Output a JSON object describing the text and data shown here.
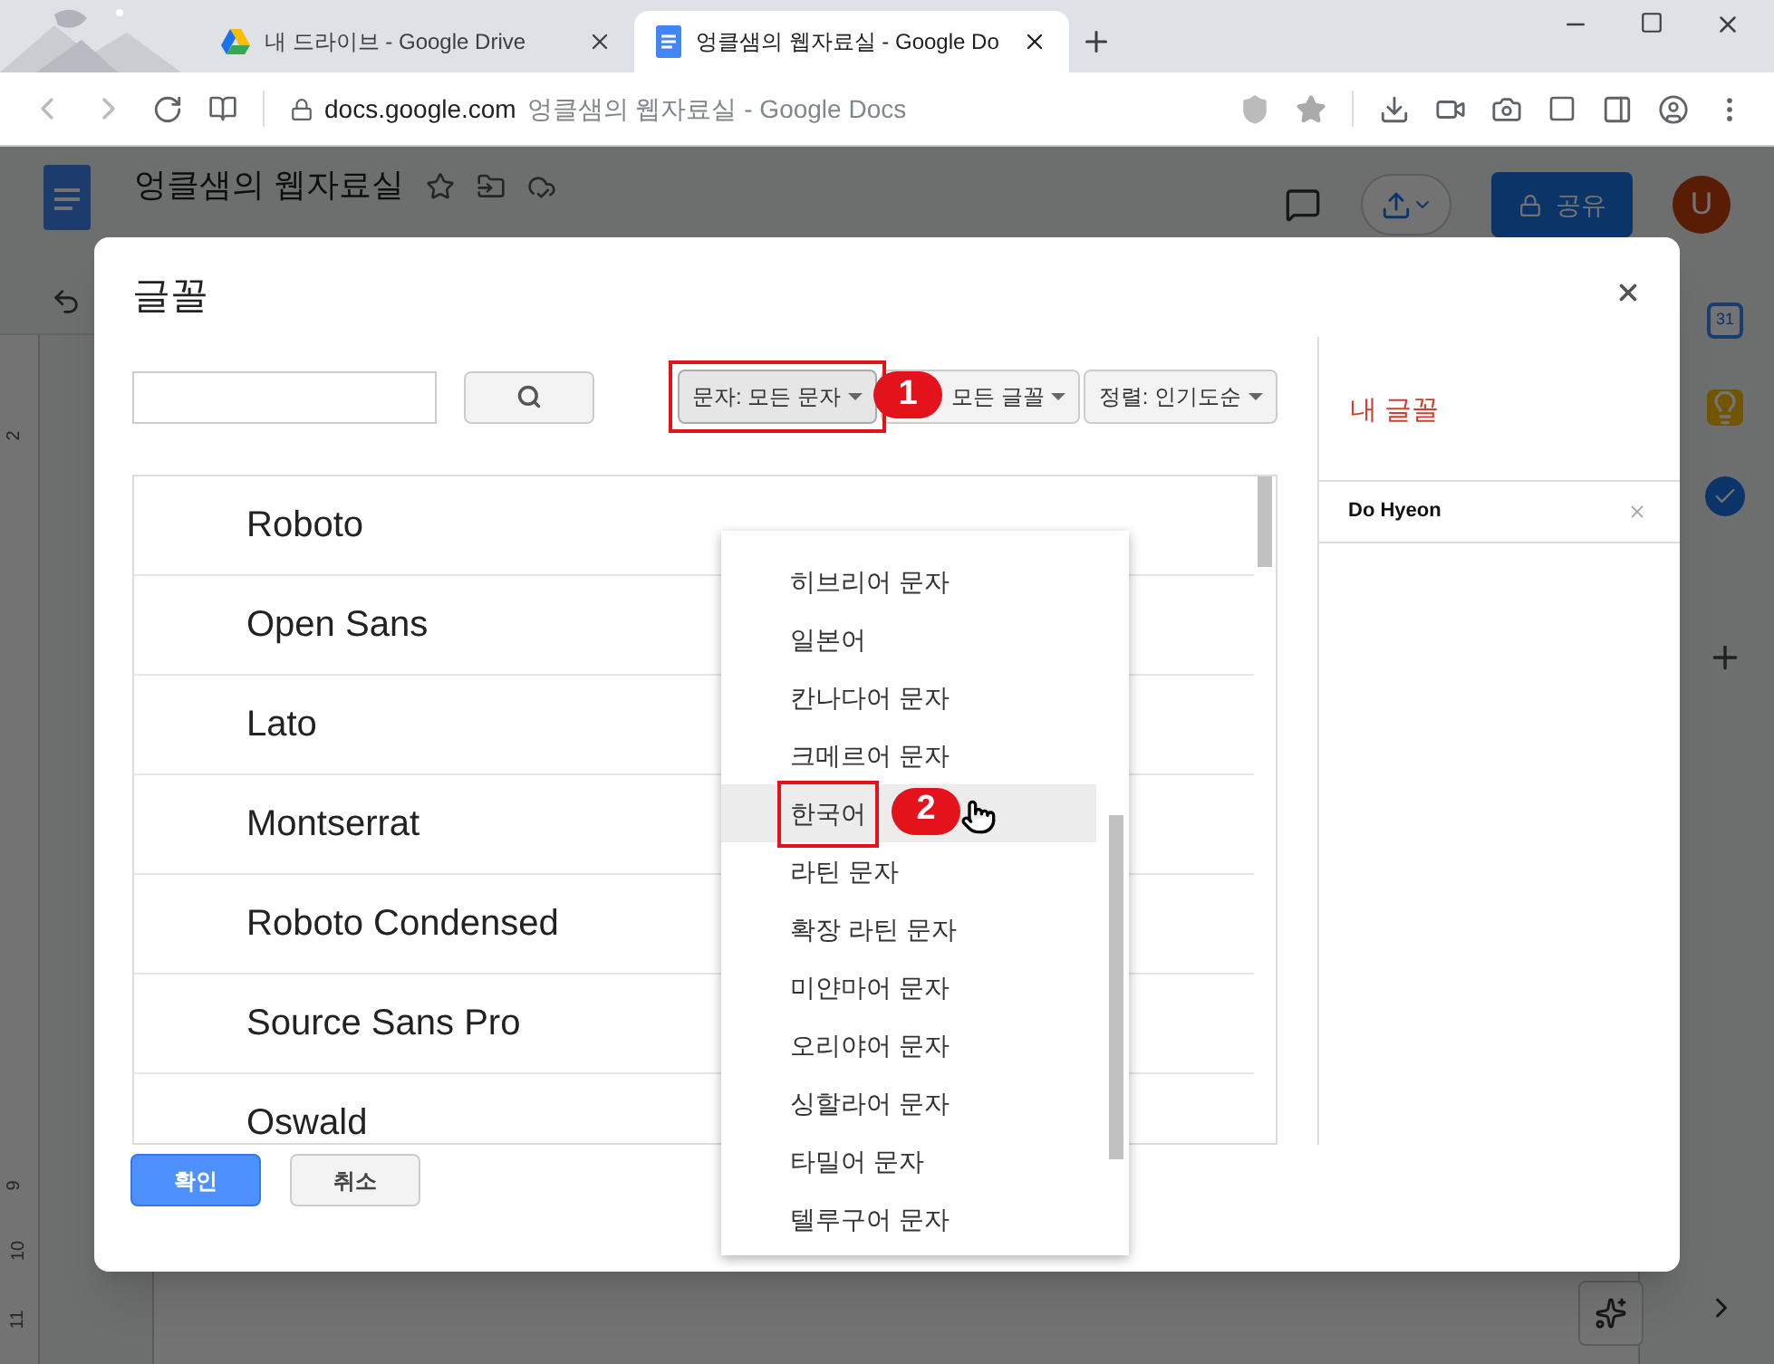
{
  "browser": {
    "tabs": [
      {
        "title": "내 드라이브 - Google Drive",
        "kind": "drive",
        "selected": false
      },
      {
        "title": "엉클샘의 웹자료실 - Google Do",
        "kind": "docs",
        "selected": true
      }
    ],
    "url": {
      "domain": "docs.google.com",
      "page_title": "엉클샘의 웹자료실 - Google Docs"
    }
  },
  "docs": {
    "title": "엉클샘의 웹자료실",
    "share_label": "공유",
    "avatar_letter": "U",
    "calendar_day": "31",
    "ruler_numbers": [
      "2",
      "9",
      "10",
      "11"
    ]
  },
  "dialog": {
    "title": "글꼴",
    "filters": [
      {
        "label": "문자: 모든 문자",
        "open": true,
        "annotation": "1"
      },
      {
        "label": "모든 글꼴",
        "open": false
      },
      {
        "label": "정렬: 인기도순",
        "open": false
      }
    ],
    "fonts": [
      "Roboto",
      "Open Sans",
      "Lato",
      "Montserrat",
      "Roboto Condensed",
      "Source Sans Pro",
      "Oswald"
    ],
    "dropdown": [
      {
        "label": "히브리어 문자",
        "hovered": false
      },
      {
        "label": "일본어",
        "hovered": false
      },
      {
        "label": "칸나다어 문자",
        "hovered": false
      },
      {
        "label": "크메르어 문자",
        "hovered": false
      },
      {
        "label": "한국어",
        "hovered": true,
        "annotation": "2"
      },
      {
        "label": "라틴 문자",
        "hovered": false
      },
      {
        "label": "확장 라틴 문자",
        "hovered": false
      },
      {
        "label": "미얀마어 문자",
        "hovered": false
      },
      {
        "label": "오리야어 문자",
        "hovered": false
      },
      {
        "label": "싱할라어 문자",
        "hovered": false
      },
      {
        "label": "타밀어 문자",
        "hovered": false
      },
      {
        "label": "텔루구어 문자",
        "hovered": false
      }
    ],
    "my_fonts": {
      "title": "내 글꼴",
      "items": [
        "Do Hyeon"
      ]
    },
    "buttons": [
      {
        "label": "확인",
        "kind": "primary"
      },
      {
        "label": "취소",
        "kind": "secondary"
      }
    ]
  }
}
